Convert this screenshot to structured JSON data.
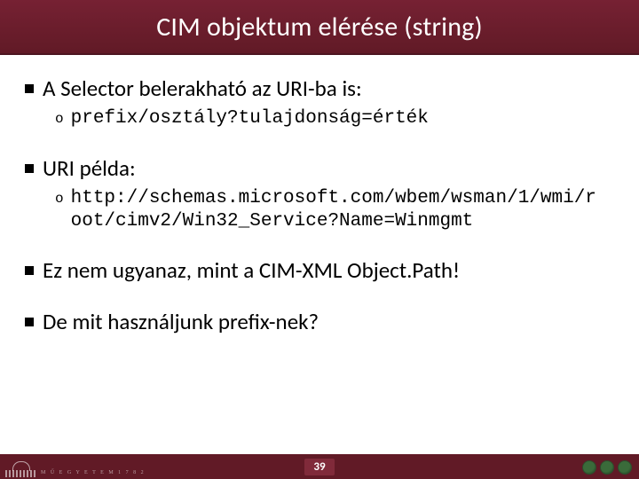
{
  "title": "CIM objektum elérése (string)",
  "bullets": [
    {
      "text": "A Selector belerakható az URI-ba is:",
      "sub": [
        {
          "text": "prefix/osztály?tulajdonság=érték"
        }
      ]
    },
    {
      "text": "URI példa:",
      "sub": [
        {
          "text": "http://schemas.microsoft.com/wbem/wsman/1/wmi/root/cimv2/Win32_Service?Name=Winmgmt"
        }
      ]
    },
    {
      "text": "Ez nem ugyanaz, mint a CIM-XML Object.Path!",
      "sub": []
    },
    {
      "text": "De mit használjunk prefix-nek?",
      "sub": []
    }
  ],
  "footer": {
    "page": "39",
    "university": "M Ű E G Y E T E M  1 7 8 2"
  }
}
